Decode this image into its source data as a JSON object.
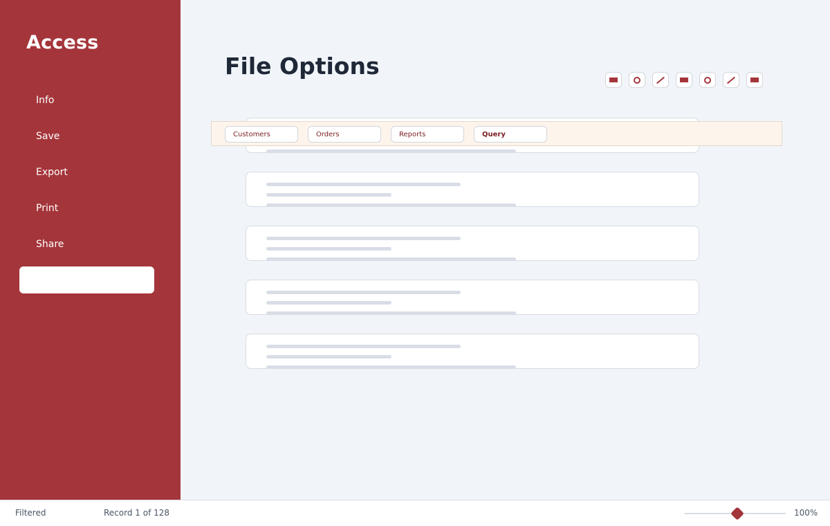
{
  "sidebar": {
    "app_title": "Access",
    "items": [
      {
        "label": "Info"
      },
      {
        "label": "Save"
      },
      {
        "label": "Export"
      },
      {
        "label": "Print"
      },
      {
        "label": "Share"
      },
      {
        "label": ""
      }
    ]
  },
  "main": {
    "title": "File Options",
    "toolbar": {
      "tools": [
        {
          "icon": "rectangle-icon"
        },
        {
          "icon": "circle-icon"
        },
        {
          "icon": "line-icon"
        },
        {
          "icon": "rectangle-icon"
        },
        {
          "icon": "circle-icon"
        },
        {
          "icon": "line-icon"
        },
        {
          "icon": "rectangle-icon"
        }
      ]
    },
    "tabs": [
      {
        "label": "Customers"
      },
      {
        "label": "Orders"
      },
      {
        "label": "Reports"
      },
      {
        "label": "Query",
        "active": true
      }
    ]
  },
  "status": {
    "filter": "Filtered",
    "record": "Record 1 of 128",
    "zoom": "100%"
  },
  "colors": {
    "accent": "#a4353a",
    "background": "#f1f5fa",
    "title": "#1e2837",
    "tab_bar": "#fdf4ec"
  }
}
